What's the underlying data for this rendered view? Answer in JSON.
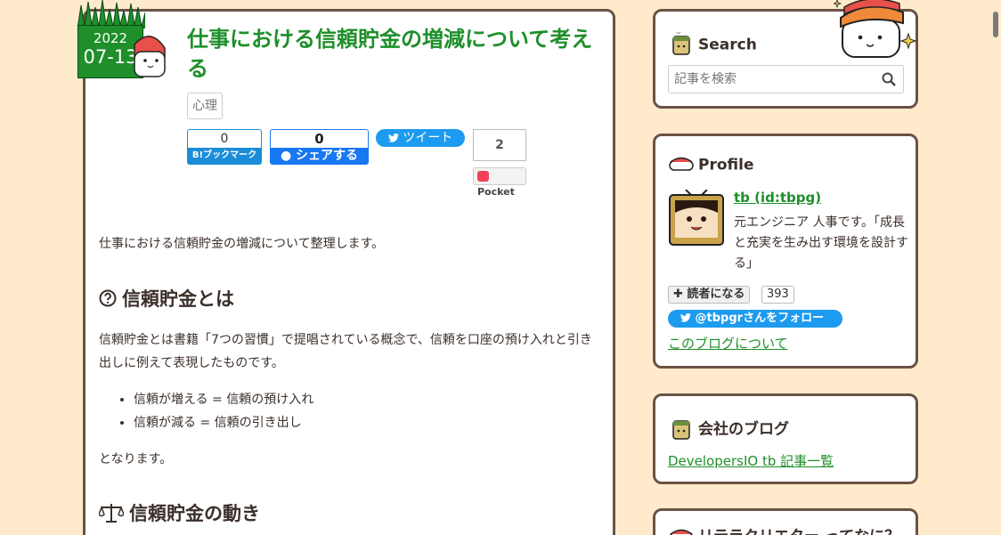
{
  "article": {
    "date_year": "2022",
    "date_md": "07-13",
    "title": "仕事における信頼貯金の増減について考える",
    "tag": "心理",
    "share": {
      "hatena_count": "0",
      "hatena_label": "ブックマーク",
      "hatena_mark": "B!",
      "fb_count": "0",
      "fb_label": "シェアする",
      "tweet_label": "ツイート",
      "pocket_count": "2",
      "pocket_label": "Pocket"
    },
    "intro": "仕事における信頼貯金の増減について整理します。",
    "h2_1": "信頼貯金とは",
    "para1": "信頼貯金とは書籍「7つの習慣」で提唱されている概念で、信頼を口座の預け入れと引き出しに例えて表現したものです。",
    "bullets": [
      "信頼が増える = 信頼の預け入れ",
      "信頼が減る = 信頼の引き出し"
    ],
    "para2": "となります。",
    "h2_2": "信頼貯金の動き"
  },
  "sidebar": {
    "search": {
      "title": "Search",
      "placeholder": "記事を検索"
    },
    "profile": {
      "title": "Profile",
      "name": "tb (id:tbpg)",
      "desc": "元エンジニア 人事です。「成長と充実を生み出す環境を設計する」",
      "reader_label": "読者になる",
      "reader_count": "393",
      "follow_label": "@tbpgrさんをフォロー",
      "about_link": "このブログについて"
    },
    "company": {
      "title": "会社のブログ",
      "link": "DevelopersIO tb 記事一覧"
    },
    "next_card_title": "リテラクリエター ってなに？"
  },
  "colors": {
    "background": "#ffebcc",
    "accent_green": "#1e8f2a",
    "border_brown": "#6a5246",
    "twitter_blue": "#1d9bf0"
  }
}
